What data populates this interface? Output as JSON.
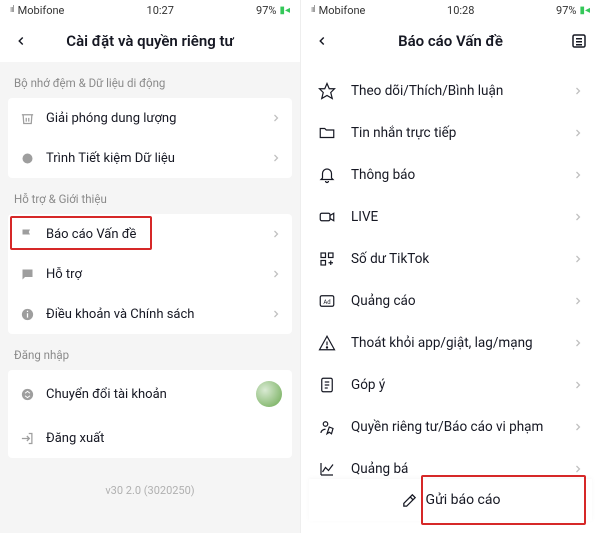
{
  "left": {
    "status": {
      "carrier": "Mobifone",
      "time": "10:27",
      "battery": "97%"
    },
    "title": "Cài đặt và quyền riêng tư",
    "sections": {
      "s1": {
        "label": "Bộ nhớ đệm & Dữ liệu di động",
        "items": {
          "i0": "Giải phóng dung lượng",
          "i1": "Trình Tiết kiệm Dữ liệu"
        }
      },
      "s2": {
        "label": "Hỗ trợ & Giới thiệu",
        "items": {
          "i0": "Báo cáo Vấn đề",
          "i1": "Hỗ trợ",
          "i2": "Điều khoản và Chính sách"
        }
      },
      "s3": {
        "label": "Đăng nhập",
        "items": {
          "i0": "Chuyển đổi tài khoản",
          "i1": "Đăng xuất"
        }
      }
    },
    "version": "v30 2.0 (3020250)"
  },
  "right": {
    "status": {
      "carrier": "Mobifone",
      "time": "10:28",
      "battery": "97%"
    },
    "title": "Báo cáo Vấn đề",
    "items": {
      "i0": "Theo dõi/Thích/Bình luận",
      "i1": "Tin nhắn trực tiếp",
      "i2": "Thông báo",
      "i3": "LIVE",
      "i4": "Số dư TikTok",
      "i5": "Quảng cáo",
      "i6": "Thoát khỏi app/giật, lag/mạng",
      "i7": "Góp ý",
      "i8": "Quyền riêng tư/Báo cáo vi phạm",
      "i9": "Quảng bá"
    },
    "send": "Gửi báo cáo"
  }
}
